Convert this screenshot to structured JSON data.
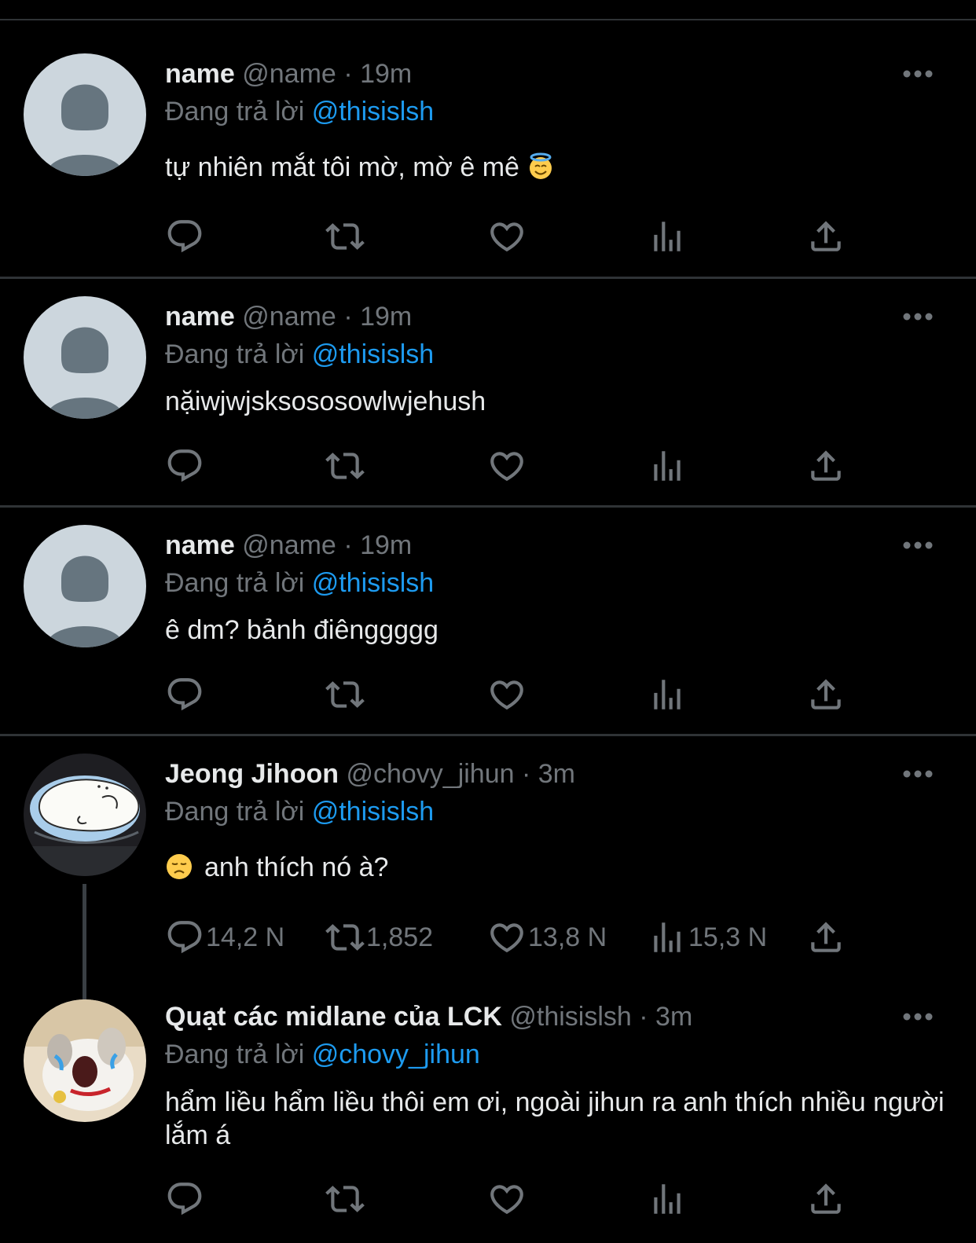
{
  "colors": {
    "background": "#000000",
    "text": "#e7e9ea",
    "muted": "#71767b",
    "link": "#1d9bf0",
    "divider": "#2f3336"
  },
  "icons": {
    "reply": "reply-icon",
    "retweet": "retweet-icon",
    "like": "heart-icon",
    "views": "views-icon",
    "share": "share-icon",
    "more": "more-dots-icon"
  },
  "tweets": [
    {
      "name": "name",
      "handle": "@name",
      "dot": "·",
      "time": "19m",
      "reply_prefix": "Đang trả lời",
      "reply_to": "@thisislsh",
      "text": "tự nhiên mắt tôi mờ, mờ ê mê",
      "emoji": "smiling-face-with-halo-emoji",
      "counts": {
        "reply": "",
        "retweet": "",
        "like": "",
        "views": ""
      }
    },
    {
      "name": "name",
      "handle": "@name",
      "dot": "·",
      "time": "19m",
      "reply_prefix": "Đang trả lời",
      "reply_to": "@thisislsh",
      "text": "nặiwjwjsksososowlwjehush",
      "counts": {
        "reply": "",
        "retweet": "",
        "like": "",
        "views": ""
      }
    },
    {
      "name": "name",
      "handle": "@name",
      "dot": "·",
      "time": "19m",
      "reply_prefix": "Đang trả lời",
      "reply_to": "@thisislsh",
      "text": "ê dm? bảnh điênggggg",
      "counts": {
        "reply": "",
        "retweet": "",
        "like": "",
        "views": ""
      }
    },
    {
      "name": "Jeong Jihoon",
      "handle": "@chovy_jihun",
      "dot": "·",
      "time": "3m",
      "reply_prefix": "Đang trả lời",
      "reply_to": "@thisislsh",
      "text": "anh thích nó à?",
      "emoji": "disappointed-face-emoji",
      "counts": {
        "reply": "14,2 N",
        "retweet": "1,852",
        "like": "13,8 N",
        "views": "15,3 N"
      }
    },
    {
      "name": "Quạt các midlane của LCK",
      "handle": "@thisislsh",
      "dot": "·",
      "time": "3m",
      "reply_prefix": "Đang trả lời",
      "reply_to": "@chovy_jihun",
      "text": "hẩm liều hẩm liều thôi em ơi, ngoài jihun ra anh thích nhiều người lắm á",
      "counts": {
        "reply": "",
        "retweet": "",
        "like": "",
        "views": ""
      }
    }
  ]
}
